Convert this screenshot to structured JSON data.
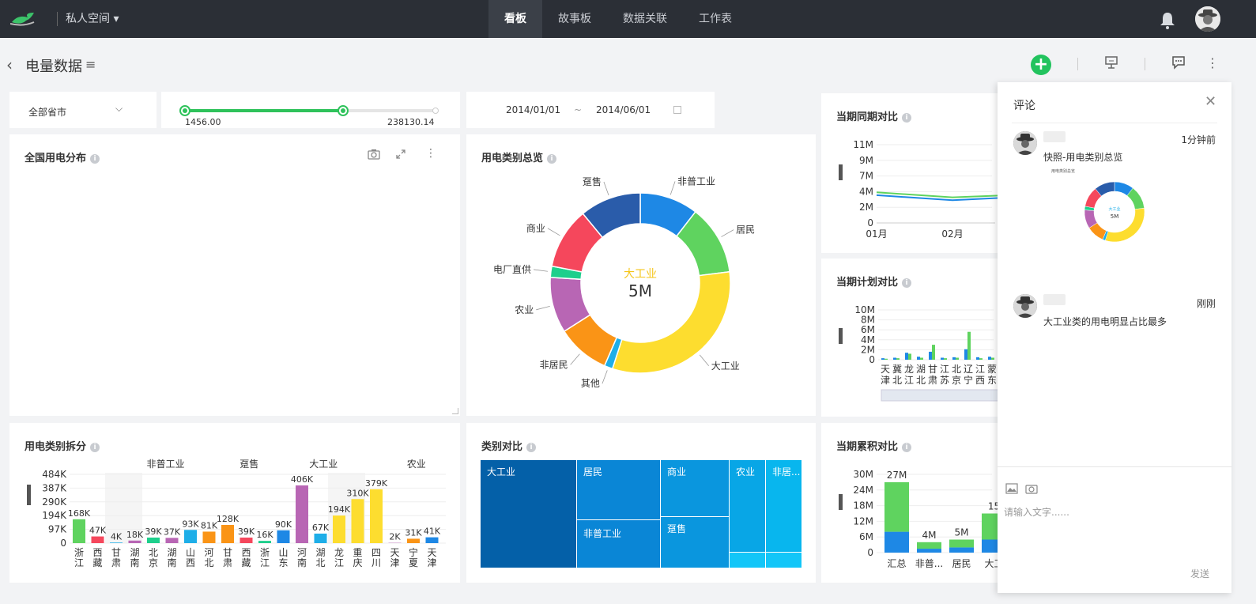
{
  "topbar": {
    "space_label": "私人空间",
    "nav": [
      "看板",
      "故事板",
      "数据关联",
      "工作表"
    ],
    "active_nav": 0
  },
  "page": {
    "title": "电量数据"
  },
  "filters": {
    "province_select": "全部省市",
    "range_min": "1456.00",
    "range_max": "238130.14",
    "range_low_fraction": 0.0,
    "range_high_fraction": 0.63,
    "date_start": "2014/01/01",
    "date_sep": "~",
    "date_end": "2014/06/01"
  },
  "cards": {
    "map": "全国用电分布",
    "donut": "用电类别总览",
    "yoy": "当期同期对比",
    "plan": "当期计划对比",
    "split": "用电类别拆分",
    "treemap": "类别对比",
    "cumulative": "当期累积对比"
  },
  "donut": {
    "center_label": "大工业",
    "center_value": "5M"
  },
  "colors": {
    "accent": "#22c35e",
    "dark_topbar": "#2b2f36",
    "slider_green": "#2fc25b"
  },
  "chart_data": [
    {
      "type": "pie",
      "title": "用电类别总览",
      "categories": [
        "非普工业",
        "居民",
        "大工业",
        "其他",
        "非居民",
        "农业",
        "电厂直供",
        "商业",
        "趸售"
      ],
      "values": [
        0.105,
        0.125,
        0.32,
        0.015,
        0.095,
        0.1,
        0.02,
        0.11,
        0.11
      ],
      "colors": [
        "#1e88e5",
        "#5fd35f",
        "#fddd2f",
        "#1eaee8",
        "#fa9416",
        "#b866b4",
        "#1ecf8c",
        "#f5475c",
        "#2a5caa"
      ]
    },
    {
      "type": "bar",
      "title": "用电类别拆分",
      "groups": [
        "非普工业",
        "趸售",
        "大工业",
        "农业"
      ],
      "categories": [
        "浙江",
        "西藏",
        "甘肃",
        "湖南",
        "北京",
        "湖南",
        "山西",
        "河北",
        "甘肃",
        "西藏",
        "浙江",
        "山东",
        "河南",
        "湖北",
        "龙江",
        "重庆",
        "四川",
        "天津",
        "宁夏",
        "天津"
      ],
      "values": [
        168,
        47,
        4,
        18,
        39,
        37,
        93,
        81,
        128,
        39,
        16,
        90,
        406,
        67,
        194,
        310,
        379,
        2,
        31,
        41
      ],
      "labels": [
        "168K",
        "47K",
        "4K",
        "18K",
        "39K",
        "37K",
        "93K",
        "81K",
        "128K",
        "39K",
        "16K",
        "90K",
        "406K",
        "67K",
        "194K",
        "310K",
        "379K",
        "2K",
        "31K",
        "41K"
      ],
      "colors": [
        "#5fd35f",
        "#f5475c",
        "#1eaee8",
        "#b866b4",
        "#1ecf8c",
        "#b866b4",
        "#1eaee8",
        "#fa9416",
        "#fa9416",
        "#f5475c",
        "#1ecf8c",
        "#1e88e5",
        "#b866b4",
        "#1eaee8",
        "#fddd2f",
        "#fddd2f",
        "#fddd2f",
        "#b866b4",
        "#fa9416",
        "#1e88e5"
      ],
      "yticks": [
        "484K",
        "387K",
        "290K",
        "194K",
        "97K",
        "0"
      ],
      "ylim": [
        0,
        484
      ]
    },
    {
      "type": "line",
      "title": "当期同期对比",
      "x": [
        "01月",
        "02月"
      ],
      "yticks": [
        "11M",
        "9M",
        "7M",
        "4M",
        "2M",
        "0"
      ],
      "ylim": [
        0,
        11
      ],
      "series": [
        {
          "values": [
            4.3,
            3.6,
            4.0
          ],
          "color": "#5fd35f"
        },
        {
          "values": [
            3.9,
            3.2,
            3.7
          ],
          "color": "#1e88e5"
        }
      ]
    },
    {
      "type": "bar",
      "title": "当期计划对比",
      "categories": [
        "天津",
        "冀北",
        "龙江",
        "湖北",
        "甘肃",
        "江苏",
        "北京",
        "辽宁",
        "江西",
        "蒙东"
      ],
      "yticks": [
        "10M",
        "8M",
        "6M",
        "4M",
        "2M",
        "0"
      ],
      "ylim": [
        0,
        10
      ],
      "series": [
        {
          "values": [
            0.3,
            0.4,
            1.4,
            0.6,
            1.6,
            0.4,
            0.5,
            2.1,
            0.5,
            0.6
          ],
          "color": "#1e88e5"
        },
        {
          "values": [
            0.2,
            0.3,
            1.2,
            0.4,
            3.0,
            0.3,
            0.4,
            5.6,
            0.3,
            0.4
          ],
          "color": "#5fd35f"
        }
      ]
    },
    {
      "type": "bar",
      "title": "当期累积对比",
      "categories": [
        "汇总",
        "非普...",
        "居民",
        "大工"
      ],
      "yticks": [
        "30M",
        "24M",
        "18M",
        "12M",
        "6M",
        "0"
      ],
      "ylim": [
        0,
        30
      ],
      "labels": [
        "27M",
        "4M",
        "5M",
        "15"
      ],
      "series": [
        {
          "values": [
            8,
            1.5,
            2,
            5
          ],
          "color": "#1e88e5"
        },
        {
          "values": [
            19,
            2.5,
            3,
            10
          ],
          "color": "#5fd35f"
        }
      ]
    },
    {
      "type": "heatmap",
      "title": "类别对比",
      "cells": [
        {
          "label": "大工业",
          "color": "#0460a8"
        },
        {
          "label": "居民",
          "color": "#0a86d6"
        },
        {
          "label": "非普工业",
          "color": "#0a86d6"
        },
        {
          "label": "商业",
          "color": "#0a96de"
        },
        {
          "label": "趸售",
          "color": "#0a96de"
        },
        {
          "label": "农业",
          "color": "#08a6e6"
        },
        {
          "label": "非居...",
          "color": "#08b6ee"
        },
        {
          "label": "",
          "color": "#12c6f8"
        },
        {
          "label": "",
          "color": "#12c6f8"
        }
      ]
    }
  ],
  "comments": {
    "title": "评论",
    "items": [
      {
        "time": "1分钟前",
        "text": "快照-用电类别总览",
        "thumb_title": "用电类别总览",
        "thumb_center": "大工业",
        "thumb_value": "5M"
      },
      {
        "time": "刚刚",
        "text": "大工业类的用电明显占比最多"
      }
    ],
    "input_placeholder": "请输入文字......",
    "send_label": "发送"
  }
}
